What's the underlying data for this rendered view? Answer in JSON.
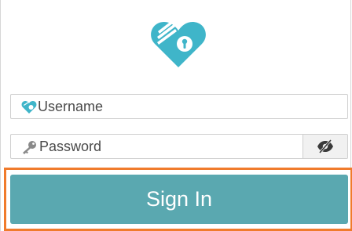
{
  "login": {
    "username_placeholder": "Username",
    "password_placeholder": "Password",
    "signin_label": "Sign In"
  },
  "colors": {
    "brand": "#3fb5c9",
    "button": "#5aa8b0",
    "highlight": "#f07b2c"
  },
  "icons": {
    "logo": "heart-lock-logo",
    "username": "heart-icon",
    "password": "key-icon",
    "visibility": "eye-slash-icon"
  }
}
